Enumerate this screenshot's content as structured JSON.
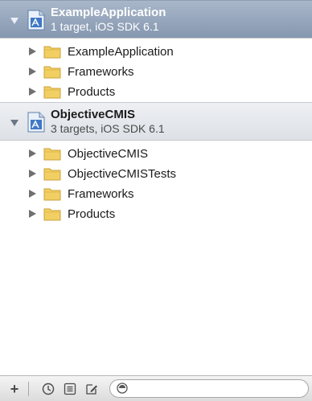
{
  "projects": [
    {
      "title": "ExampleApplication",
      "subtitle": "1 target, iOS SDK 6.1",
      "selected": true,
      "groups": [
        {
          "label": "ExampleApplication"
        },
        {
          "label": "Frameworks"
        },
        {
          "label": "Products"
        }
      ]
    },
    {
      "title": "ObjectiveCMIS",
      "subtitle": "3 targets, iOS SDK 6.1",
      "selected": false,
      "groups": [
        {
          "label": "ObjectiveCMIS"
        },
        {
          "label": "ObjectiveCMISTests"
        },
        {
          "label": "Frameworks"
        },
        {
          "label": "Products"
        }
      ]
    }
  ],
  "icons": {
    "project": "xcode-project-icon",
    "group": "folder-icon",
    "add": "plus-icon",
    "recent": "clock-icon",
    "scm": "source-control-icon",
    "unsaved": "edited-file-icon",
    "filter": "filter-icon"
  },
  "colors": {
    "selected_header_top": "#a9b7c9",
    "selected_header_bottom": "#8597b0",
    "folder": "#f2cf63"
  },
  "bottom_bar": {
    "add_label": "+",
    "filter_value": ""
  }
}
